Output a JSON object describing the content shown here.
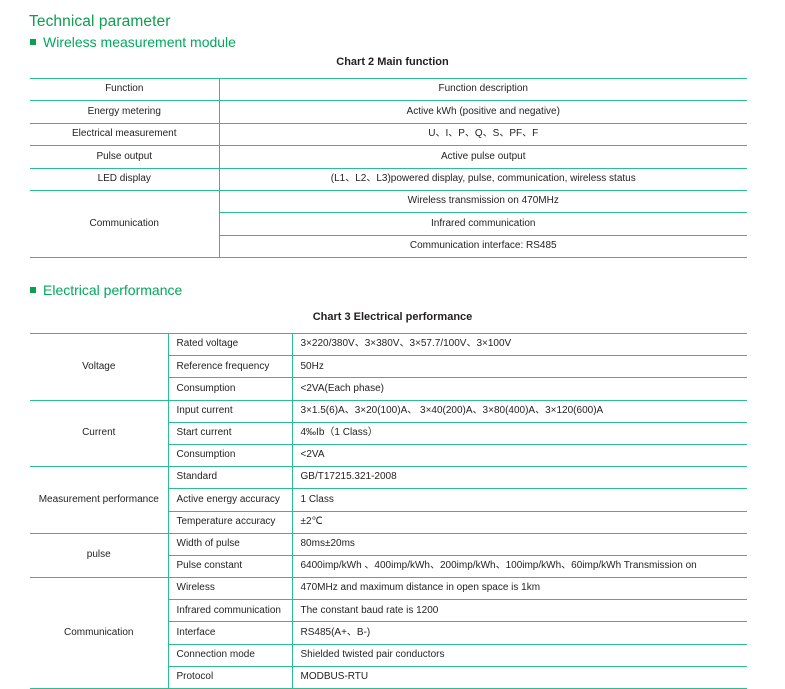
{
  "document": {
    "main_heading": "Technical parameter"
  },
  "sections": [
    {
      "heading": "Wireless measurement module",
      "caption": "Chart 2 Main function"
    },
    {
      "heading": "Electrical performance",
      "caption": "Chart 3 Electrical performance"
    }
  ],
  "table_main_function": {
    "header": {
      "function": "Function",
      "description": "Function description"
    },
    "rows": [
      {
        "function": "Energy metering",
        "description": "Active kWh (positive and negative)"
      },
      {
        "function": "Electrical measurement",
        "description": "U、I、P、Q、S、PF、F"
      },
      {
        "function": "Pulse output",
        "description": "Active pulse output"
      },
      {
        "function": "LED display",
        "description": "(L1、L2、L3)powered display, pulse, communication, wireless status"
      }
    ],
    "communication": {
      "label": "Communication",
      "descriptions": [
        "Wireless transmission on 470MHz",
        "Infrared communication",
        "Communication interface: RS485"
      ]
    }
  },
  "table_electrical": {
    "groups": [
      {
        "name": "Voltage",
        "rows": [
          {
            "param": "Rated voltage",
            "value": "3×220/380V、3×380V、3×57.7/100V、3×100V"
          },
          {
            "param": "Reference frequency",
            "value": "50Hz"
          },
          {
            "param": "Consumption",
            "value": "<2VA(Each phase)"
          }
        ]
      },
      {
        "name": "Current",
        "rows": [
          {
            "param": "Input current",
            "value": "3×1.5(6)A、3×20(100)A、 3×40(200)A、3×80(400)A、3×120(600)A"
          },
          {
            "param": "Start current",
            "value": "4‰Ib（1 Class）"
          },
          {
            "param": "Consumption",
            "value": "<2VA"
          }
        ]
      },
      {
        "name": "Measurement performance",
        "rows": [
          {
            "param": "Standard",
            "value": "GB/T17215.321-2008"
          },
          {
            "param": "Active energy accuracy",
            "value": "1 Class"
          },
          {
            "param": "Temperature accuracy",
            "value": "±2℃"
          }
        ]
      },
      {
        "name": "pulse",
        "rows": [
          {
            "param": "Width of pulse",
            "value": "80ms±20ms"
          },
          {
            "param": "Pulse constant",
            "value": "6400imp/kWh 、400imp/kWh、200imp/kWh、100imp/kWh、60imp/kWh  Transmission on"
          }
        ]
      },
      {
        "name": "Communication",
        "rows": [
          {
            "param": "Wireless",
            "value": "470MHz and maximum distance in open space is 1km"
          },
          {
            "param": "Infrared communication",
            "value": "The constant baud rate is 1200"
          },
          {
            "param": "Interface",
            "value": "RS485(A+、B-)"
          },
          {
            "param": "Connection mode",
            "value": "Shielded twisted pair conductors"
          },
          {
            "param": "Protocol",
            "value": "MODBUS-RTU"
          }
        ]
      }
    ]
  },
  "colors": {
    "heading_dark_green": "#0f9d4f",
    "heading_green": "#00a95c",
    "table_line_green": "#2ebd93",
    "text": "#231f20"
  }
}
